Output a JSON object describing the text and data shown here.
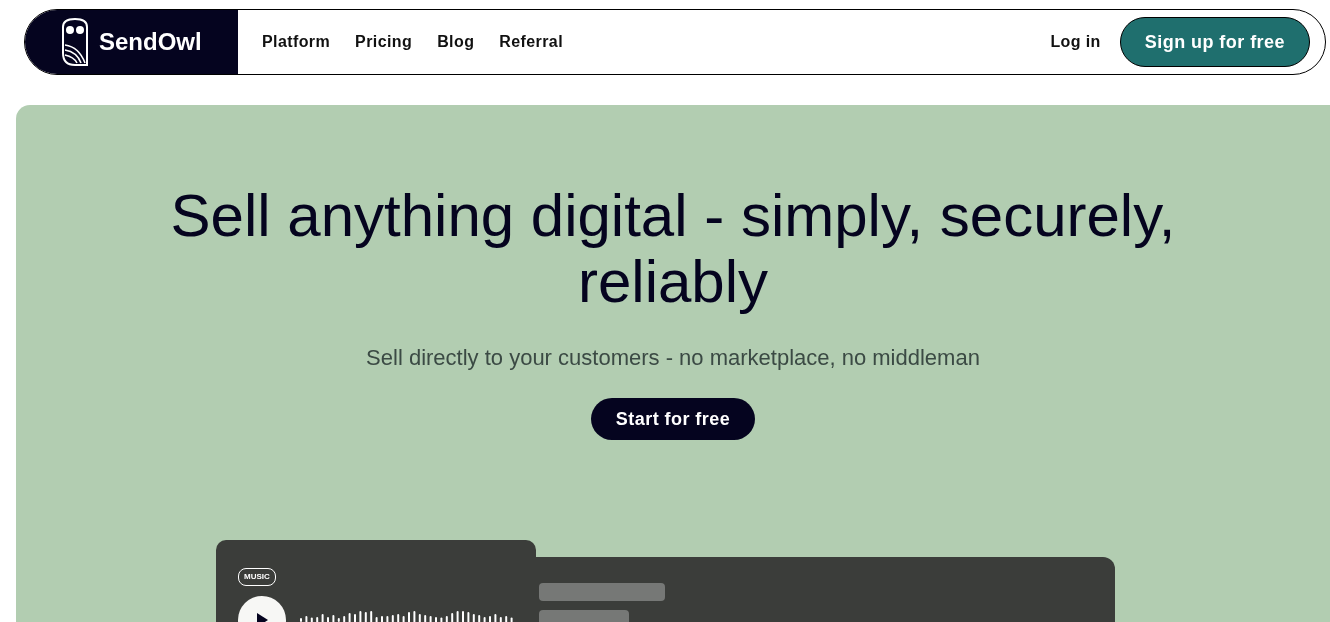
{
  "header": {
    "logo": "SendOwl",
    "nav": [
      "Platform",
      "Pricing",
      "Blog",
      "Referral"
    ],
    "login": "Log in",
    "signup": "Sign up for free"
  },
  "hero": {
    "title": "Sell anything digital - simply, securely, reliably",
    "subtitle": "Sell directly to your customers - no marketplace, no middleman",
    "cta": "Start for free"
  },
  "music_card": {
    "tag": "MUSIC"
  }
}
